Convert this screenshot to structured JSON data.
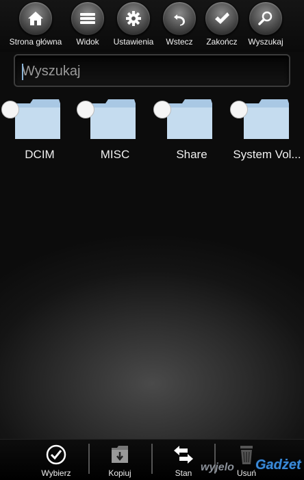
{
  "toolbar": {
    "items": [
      {
        "label": "Strona główna",
        "icon": "home-icon"
      },
      {
        "label": "Widok",
        "icon": "list-icon"
      },
      {
        "label": "Ustawienia",
        "icon": "gear-icon"
      },
      {
        "label": "Wstecz",
        "icon": "undo-arrow-icon"
      },
      {
        "label": "Zakończ",
        "icon": "checkmark-icon"
      },
      {
        "label": "Wyszukaj",
        "icon": "magnifier-icon"
      }
    ]
  },
  "search": {
    "placeholder": "Wyszukaj",
    "value": ""
  },
  "folders": [
    {
      "name": "DCIM"
    },
    {
      "name": "MISC"
    },
    {
      "name": "Share"
    },
    {
      "name": "System Vol..."
    }
  ],
  "bottombar": {
    "items": [
      {
        "label": "Wybierz",
        "icon": "check-circle-icon"
      },
      {
        "label": "Kopiuj",
        "icon": "copy-folder-icon"
      },
      {
        "label": "Stan",
        "icon": "swap-arrows-icon"
      },
      {
        "label": "Usuń",
        "icon": "trash-icon"
      }
    ]
  },
  "watermark": {
    "part1": "wyjelo",
    "part2": "Gadżet"
  },
  "colors": {
    "folder": "#c5dcef",
    "accent": "#3a8ad8",
    "background": "#141414"
  }
}
